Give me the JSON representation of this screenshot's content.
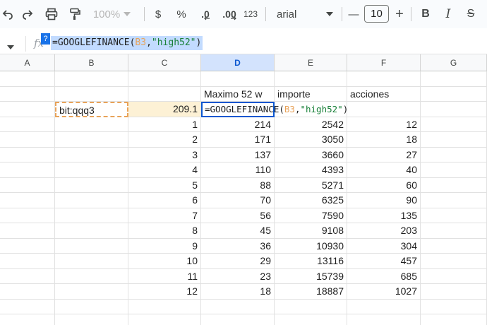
{
  "toolbar": {
    "zoom": "100%",
    "currency_label": "$",
    "percent_label": "%",
    "decrease_decimals_label": ".0",
    "increase_decimals_label": ".00",
    "number_format_label": "123",
    "font_family": "arial",
    "font_size": "10",
    "minus_label": "—",
    "plus_label": "+",
    "bold_label": "B",
    "italic_label": "I",
    "strike_label": "S"
  },
  "formula_bar": {
    "fx": "fx",
    "help_badge": "?",
    "func": "=GOOGLEFINANCE(",
    "ref": "B3",
    "comma": ",",
    "str": "\"high52\"",
    "close": ")"
  },
  "columns": [
    "A",
    "B",
    "C",
    "D",
    "E",
    "F",
    "G"
  ],
  "headers_row": {
    "D": "Maximo 52 w",
    "E": "importe",
    "F": "acciones"
  },
  "row3": {
    "B": "bit:qqq3",
    "C": "209.1"
  },
  "rows": [
    {
      "C": "1",
      "D": "214",
      "E": "2542",
      "F": "12"
    },
    {
      "C": "2",
      "D": "171",
      "E": "3050",
      "F": "18"
    },
    {
      "C": "3",
      "D": "137",
      "E": "3660",
      "F": "27"
    },
    {
      "C": "4",
      "D": "110",
      "E": "4393",
      "F": "40"
    },
    {
      "C": "5",
      "D": "88",
      "E": "5271",
      "F": "60"
    },
    {
      "C": "6",
      "D": "70",
      "E": "6325",
      "F": "90"
    },
    {
      "C": "7",
      "D": "56",
      "E": "7590",
      "F": "135"
    },
    {
      "C": "8",
      "D": "45",
      "E": "9108",
      "F": "203"
    },
    {
      "C": "9",
      "D": "36",
      "E": "10930",
      "F": "304"
    },
    {
      "C": "10",
      "D": "29",
      "E": "13116",
      "F": "457"
    },
    {
      "C": "11",
      "D": "23",
      "E": "15739",
      "F": "685"
    },
    {
      "C": "12",
      "D": "18",
      "E": "18887",
      "F": "1027"
    }
  ],
  "colors": {
    "accent": "#0b57d0",
    "ref_highlight": "#e8a35a",
    "string": "#188038"
  }
}
